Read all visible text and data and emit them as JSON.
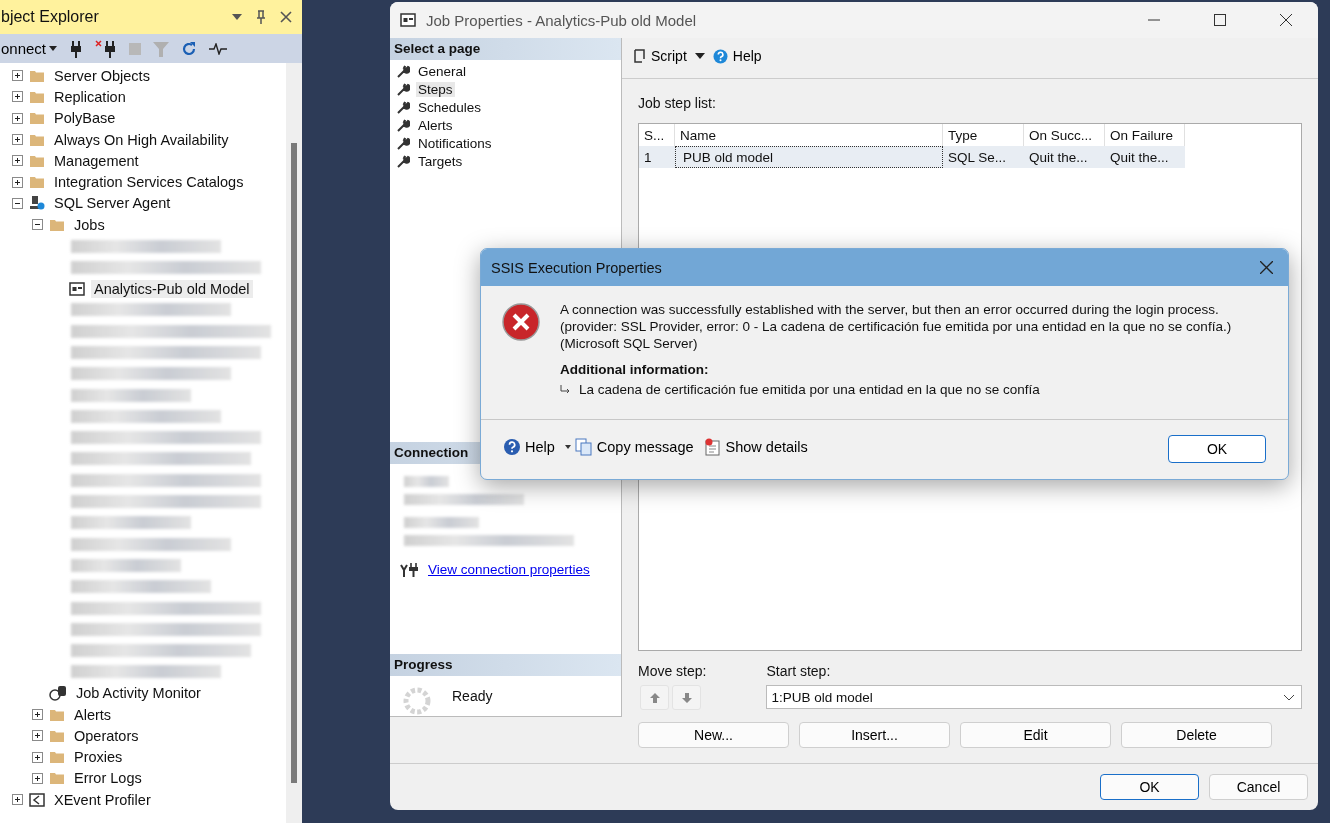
{
  "object_explorer": {
    "title": "bject Explorer",
    "toolbar": {
      "connect": "onnect"
    },
    "tree": [
      {
        "kind": "folder",
        "label": "Server Objects",
        "expanded": false
      },
      {
        "kind": "folder",
        "label": "Replication",
        "expanded": false
      },
      {
        "kind": "folder",
        "label": "PolyBase",
        "expanded": false
      },
      {
        "kind": "folder",
        "label": "Always On High Availability",
        "expanded": false
      },
      {
        "kind": "folder",
        "label": "Management",
        "expanded": false
      },
      {
        "kind": "folder",
        "label": "Integration Services Catalogs",
        "expanded": false
      },
      {
        "kind": "agent",
        "label": "SQL Server Agent",
        "expanded": true,
        "children": [
          {
            "kind": "folder",
            "label": "Jobs",
            "expanded": true,
            "children": [
              {
                "kind": "blurred",
                "selected": false
              },
              {
                "kind": "blurred",
                "selected": false
              },
              {
                "kind": "job",
                "label": "Analytics-Pub old Model",
                "selected": true
              },
              {
                "kind": "blurred",
                "selected": false
              },
              {
                "kind": "blurred",
                "selected": false
              },
              {
                "kind": "blurred",
                "selected": false
              },
              {
                "kind": "blurred",
                "selected": false
              },
              {
                "kind": "blurred",
                "selected": false
              },
              {
                "kind": "blurred",
                "selected": false
              },
              {
                "kind": "blurred",
                "selected": false
              },
              {
                "kind": "blurred",
                "selected": false
              },
              {
                "kind": "blurred",
                "selected": false
              },
              {
                "kind": "blurred",
                "selected": false
              },
              {
                "kind": "blurred",
                "selected": false
              },
              {
                "kind": "blurred",
                "selected": false
              },
              {
                "kind": "blurred",
                "selected": false
              },
              {
                "kind": "blurred",
                "selected": false
              },
              {
                "kind": "blurred",
                "selected": false
              },
              {
                "kind": "blurred",
                "selected": false
              },
              {
                "kind": "blurred",
                "selected": false
              },
              {
                "kind": "blurred",
                "selected": false
              }
            ]
          },
          {
            "kind": "monitor",
            "label": "Job Activity Monitor"
          },
          {
            "kind": "folder",
            "label": "Alerts",
            "expanded": false
          },
          {
            "kind": "folder",
            "label": "Operators",
            "expanded": false
          },
          {
            "kind": "folder",
            "label": "Proxies",
            "expanded": false
          },
          {
            "kind": "folder",
            "label": "Error Logs",
            "expanded": false
          }
        ]
      },
      {
        "kind": "profiler",
        "label": "XEvent Profiler",
        "expanded": false
      }
    ]
  },
  "job_window": {
    "title": "Job Properties - Analytics-Pub old Model",
    "select_page": {
      "heading": "Select a page",
      "pages": [
        {
          "label": "General",
          "selected": false
        },
        {
          "label": "Steps",
          "selected": true
        },
        {
          "label": "Schedules",
          "selected": false
        },
        {
          "label": "Alerts",
          "selected": false
        },
        {
          "label": "Notifications",
          "selected": false
        },
        {
          "label": "Targets",
          "selected": false
        }
      ]
    },
    "connection": {
      "heading": "Connection",
      "link": "View connection properties"
    },
    "progress": {
      "heading": "Progress",
      "status": "Ready"
    },
    "toolbar": {
      "script": "Script",
      "help": "Help"
    },
    "step_list": {
      "label": "Job step list:",
      "columns": [
        "S...",
        "Name",
        "Type",
        "On Succ...",
        "On Failure"
      ],
      "rows": [
        {
          "cells": [
            "1",
            "PUB old model",
            "SQL Se...",
            "Quit the...",
            "Quit the..."
          ],
          "selected": true
        }
      ]
    },
    "move_step": "Move step:",
    "start_step": {
      "label": "Start step:",
      "value": "1:PUB old model"
    },
    "step_buttons": [
      "New...",
      "Insert...",
      "Edit",
      "Delete"
    ],
    "buttons": [
      "OK",
      "Cancel"
    ]
  },
  "error_dialog": {
    "title": "SSIS Execution Properties",
    "message": "A connection was successfully established with the server, but then an error occurred during the login process. (provider: SSL Provider, error: 0 - La cadena de certificación fue emitida por una entidad en la que no se confía.) (Microsoft SQL Server)",
    "additional_heading": "Additional information:",
    "detail": "La cadena de certificación fue emitida por una entidad en la que no se confía",
    "help": "Help",
    "copy": "Copy message",
    "details": "Show details",
    "ok": "OK"
  }
}
